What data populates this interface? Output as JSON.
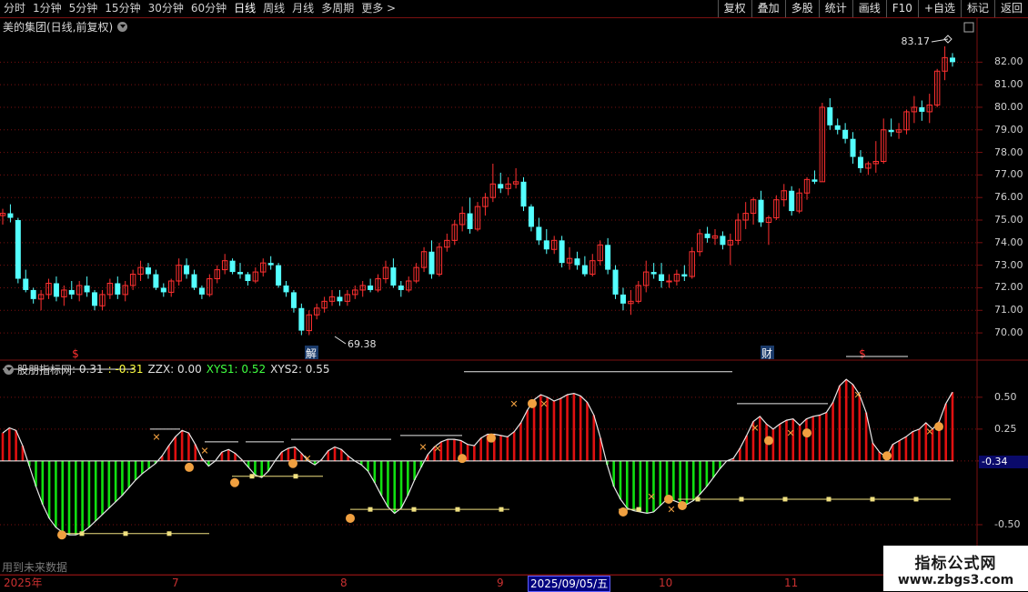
{
  "toolbar": {
    "periods": [
      "分时",
      "1分钟",
      "5分钟",
      "15分钟",
      "30分钟",
      "60分钟",
      "日线",
      "周线",
      "月线",
      "多周期",
      "更多 >"
    ],
    "active_period": "日线",
    "actions": [
      "复权",
      "叠加",
      "多股",
      "统计",
      "画线",
      "F10",
      "+自选",
      "标记",
      "返回"
    ]
  },
  "stock": {
    "title": "美的集团(日线,前复权)"
  },
  "price_axis": [
    "82.00",
    "81.00",
    "80.00",
    "79.00",
    "78.00",
    "77.00",
    "76.00",
    "75.00",
    "74.00",
    "73.00",
    "72.00",
    "71.00",
    "70.00"
  ],
  "annotations": {
    "high": "83.17",
    "low": "69.38",
    "jie": "解",
    "cai": "财",
    "dollar": "$"
  },
  "indicator": {
    "name": "股朋指标网",
    "v1": ": 0.31",
    "v2": ": -0.31",
    "zzx": "ZZX: 0.00",
    "xys1": "XYS1: 0.52",
    "xys2": "XYS2: 0.55"
  },
  "ind_axis": [
    "0.50",
    "0.25",
    "0.00",
    "-0.50"
  ],
  "ind_min": "-0.34",
  "future_label": "用到未来数据",
  "dates": {
    "year": "2025年",
    "m7": "7",
    "m8": "8",
    "m9": "9",
    "cursor": "2025/09/05/五",
    "m10": "10",
    "m11": "11"
  },
  "watermark": {
    "title": "指标公式网",
    "url": "www.zbgs3.com"
  },
  "colors": {
    "up": "#ff3030",
    "down": "#54ffff",
    "bar_up": "#e01010",
    "bar_down": "#10e010",
    "grid": "#7a1010"
  },
  "chart_data": [
    {
      "type": "candlestick",
      "title": "美的集团(日线,前复权)",
      "ylim": [
        69.6,
        82.9
      ],
      "values": [
        [
          75.2,
          75.5,
          74.8,
          75.3
        ],
        [
          75.3,
          75.7,
          74.9,
          75.1
        ],
        [
          75.0,
          75.1,
          72.2,
          72.4
        ],
        [
          72.4,
          72.8,
          71.8,
          71.9
        ],
        [
          71.9,
          72.0,
          71.3,
          71.5
        ],
        [
          71.5,
          71.9,
          71.0,
          71.7
        ],
        [
          71.7,
          72.4,
          71.5,
          72.2
        ],
        [
          72.2,
          72.5,
          71.4,
          71.6
        ],
        [
          71.6,
          72.1,
          71.2,
          71.9
        ],
        [
          71.9,
          72.3,
          71.5,
          71.7
        ],
        [
          71.7,
          72.3,
          71.4,
          72.1
        ],
        [
          72.1,
          72.5,
          71.6,
          71.8
        ],
        [
          71.8,
          71.9,
          71.0,
          71.2
        ],
        [
          71.2,
          71.9,
          71.0,
          71.7
        ],
        [
          71.7,
          72.4,
          71.5,
          72.2
        ],
        [
          72.2,
          72.5,
          71.5,
          71.7
        ],
        [
          71.7,
          72.3,
          71.4,
          72.1
        ],
        [
          72.1,
          72.8,
          71.9,
          72.6
        ],
        [
          72.6,
          73.2,
          72.3,
          72.9
        ],
        [
          72.9,
          73.1,
          72.4,
          72.6
        ],
        [
          72.6,
          72.8,
          71.9,
          72.0
        ],
        [
          72.0,
          72.2,
          71.6,
          71.8
        ],
        [
          71.8,
          72.4,
          71.6,
          72.3
        ],
        [
          72.3,
          73.3,
          72.1,
          73.0
        ],
        [
          73.0,
          73.3,
          72.4,
          72.6
        ],
        [
          72.6,
          72.8,
          71.9,
          72.0
        ],
        [
          72.0,
          72.1,
          71.5,
          71.7
        ],
        [
          71.7,
          72.6,
          71.6,
          72.4
        ],
        [
          72.4,
          73.0,
          72.2,
          72.8
        ],
        [
          72.8,
          73.5,
          72.6,
          73.2
        ],
        [
          73.2,
          73.3,
          72.6,
          72.7
        ],
        [
          72.7,
          73.1,
          72.4,
          72.6
        ],
        [
          72.6,
          72.7,
          72.1,
          72.3
        ],
        [
          72.3,
          72.9,
          72.2,
          72.7
        ],
        [
          72.7,
          73.3,
          72.5,
          73.1
        ],
        [
          73.1,
          73.4,
          72.8,
          73.0
        ],
        [
          73.0,
          73.1,
          72.0,
          72.1
        ],
        [
          72.1,
          72.3,
          71.6,
          71.8
        ],
        [
          71.8,
          71.9,
          70.9,
          71.1
        ],
        [
          71.1,
          71.3,
          69.9,
          70.1
        ],
        [
          70.1,
          71.0,
          69.9,
          70.8
        ],
        [
          70.8,
          71.3,
          70.6,
          71.1
        ],
        [
          71.1,
          71.6,
          70.9,
          71.4
        ],
        [
          71.4,
          71.9,
          71.2,
          71.6
        ],
        [
          71.6,
          71.9,
          71.2,
          71.4
        ],
        [
          71.4,
          71.9,
          71.2,
          71.7
        ],
        [
          71.7,
          72.1,
          71.5,
          71.9
        ],
        [
          71.9,
          72.3,
          71.6,
          72.1
        ],
        [
          72.1,
          72.4,
          71.8,
          71.9
        ],
        [
          71.9,
          72.6,
          71.8,
          72.4
        ],
        [
          72.4,
          73.2,
          72.2,
          72.9
        ],
        [
          72.9,
          73.3,
          72.0,
          72.1
        ],
        [
          72.1,
          72.3,
          71.6,
          71.9
        ],
        [
          71.9,
          72.5,
          71.8,
          72.3
        ],
        [
          72.3,
          73.1,
          72.2,
          72.9
        ],
        [
          72.9,
          73.8,
          72.7,
          73.6
        ],
        [
          73.6,
          74.1,
          72.4,
          72.6
        ],
        [
          72.6,
          74.0,
          72.5,
          73.8
        ],
        [
          73.8,
          74.4,
          73.6,
          74.1
        ],
        [
          74.1,
          75.0,
          73.9,
          74.8
        ],
        [
          74.8,
          75.6,
          74.5,
          75.3
        ],
        [
          75.3,
          76.0,
          74.4,
          74.6
        ],
        [
          74.6,
          75.8,
          74.5,
          75.6
        ],
        [
          75.6,
          76.2,
          75.2,
          76.0
        ],
        [
          76.0,
          77.5,
          75.8,
          76.6
        ],
        [
          76.6,
          77.1,
          76.2,
          76.4
        ],
        [
          76.4,
          76.9,
          76.1,
          76.6
        ],
        [
          76.6,
          77.3,
          76.4,
          76.7
        ],
        [
          76.7,
          76.9,
          75.4,
          75.6
        ],
        [
          75.6,
          75.7,
          74.5,
          74.7
        ],
        [
          74.7,
          75.1,
          73.9,
          74.1
        ],
        [
          74.1,
          74.6,
          73.5,
          73.7
        ],
        [
          73.7,
          74.3,
          73.5,
          74.1
        ],
        [
          74.1,
          74.3,
          72.9,
          73.1
        ],
        [
          73.1,
          73.8,
          72.8,
          73.3
        ],
        [
          73.3,
          73.6,
          72.8,
          73.0
        ],
        [
          73.0,
          73.4,
          72.5,
          72.6
        ],
        [
          72.6,
          73.5,
          72.5,
          73.2
        ],
        [
          73.2,
          74.1,
          73.0,
          73.9
        ],
        [
          73.9,
          74.2,
          72.6,
          72.8
        ],
        [
          72.8,
          73.0,
          71.5,
          71.7
        ],
        [
          71.7,
          72.0,
          71.0,
          71.3
        ],
        [
          71.3,
          71.9,
          70.8,
          71.4
        ],
        [
          71.4,
          72.3,
          71.3,
          72.1
        ],
        [
          72.1,
          73.2,
          71.8,
          72.7
        ],
        [
          72.7,
          73.1,
          72.4,
          72.6
        ],
        [
          72.6,
          73.1,
          72.0,
          72.3
        ],
        [
          72.3,
          72.6,
          72.0,
          72.3
        ],
        [
          72.3,
          72.8,
          72.1,
          72.6
        ],
        [
          72.6,
          73.0,
          72.3,
          72.5
        ],
        [
          72.5,
          73.8,
          72.4,
          73.6
        ],
        [
          73.6,
          74.6,
          73.4,
          74.4
        ],
        [
          74.4,
          74.7,
          74.0,
          74.2
        ],
        [
          74.2,
          74.6,
          73.9,
          74.3
        ],
        [
          74.3,
          74.5,
          73.7,
          73.9
        ],
        [
          73.9,
          74.4,
          73.0,
          74.1
        ],
        [
          74.1,
          75.3,
          73.9,
          75.0
        ],
        [
          75.0,
          75.8,
          74.6,
          75.3
        ],
        [
          75.3,
          76.0,
          74.8,
          75.9
        ],
        [
          75.9,
          76.3,
          74.7,
          74.9
        ],
        [
          74.9,
          75.2,
          73.9,
          75.1
        ],
        [
          75.1,
          76.1,
          75.0,
          75.9
        ],
        [
          75.9,
          76.6,
          75.6,
          76.3
        ],
        [
          76.3,
          76.5,
          75.2,
          75.4
        ],
        [
          75.4,
          76.4,
          75.3,
          76.2
        ],
        [
          76.2,
          76.9,
          75.9,
          76.8
        ],
        [
          76.8,
          77.2,
          76.6,
          76.7
        ],
        [
          76.7,
          80.2,
          76.7,
          80.0
        ],
        [
          80.0,
          80.4,
          79.0,
          79.2
        ],
        [
          79.2,
          79.5,
          78.8,
          79.0
        ],
        [
          79.0,
          79.3,
          78.4,
          78.6
        ],
        [
          78.6,
          78.9,
          77.5,
          77.8
        ],
        [
          77.8,
          78.1,
          77.1,
          77.3
        ],
        [
          77.3,
          77.6,
          77.0,
          77.5
        ],
        [
          77.5,
          78.5,
          77.1,
          77.6
        ],
        [
          77.6,
          79.5,
          77.5,
          79.0
        ],
        [
          79.0,
          79.5,
          78.7,
          78.9
        ],
        [
          78.9,
          79.3,
          78.6,
          79.0
        ],
        [
          79.0,
          79.9,
          78.8,
          79.8
        ],
        [
          79.8,
          80.5,
          79.3,
          80.0
        ],
        [
          80.0,
          80.3,
          79.4,
          79.8
        ],
        [
          79.8,
          80.6,
          79.3,
          80.1
        ],
        [
          80.1,
          81.7,
          80.0,
          81.6
        ],
        [
          81.6,
          82.7,
          81.2,
          82.2
        ],
        [
          82.2,
          82.4,
          81.8,
          82.0
        ]
      ]
    },
    {
      "type": "bar",
      "title": "股朋指标网",
      "ylim": [
        -0.65,
        0.72
      ],
      "values": [
        0.22,
        0.26,
        0.24,
        0.12,
        -0.04,
        -0.2,
        -0.34,
        -0.45,
        -0.52,
        -0.56,
        -0.58,
        -0.58,
        -0.56,
        -0.52,
        -0.47,
        -0.42,
        -0.37,
        -0.32,
        -0.27,
        -0.21,
        -0.15,
        -0.1,
        -0.06,
        -0.02,
        0.04,
        0.12,
        0.19,
        0.24,
        0.22,
        0.13,
        0.02,
        -0.04,
        0.0,
        0.07,
        0.09,
        0.06,
        0.01,
        -0.05,
        -0.11,
        -0.13,
        -0.08,
        0.0,
        0.07,
        0.1,
        0.11,
        0.06,
        0.0,
        -0.03,
        0.01,
        0.08,
        0.11,
        0.09,
        0.04,
        0.0,
        -0.03,
        -0.08,
        -0.17,
        -0.27,
        -0.36,
        -0.41,
        -0.37,
        -0.27,
        -0.15,
        -0.05,
        0.05,
        0.11,
        0.15,
        0.17,
        0.17,
        0.16,
        0.13,
        0.12,
        0.18,
        0.21,
        0.21,
        0.2,
        0.19,
        0.23,
        0.3,
        0.4,
        0.48,
        0.52,
        0.5,
        0.47,
        0.49,
        0.52,
        0.53,
        0.51,
        0.46,
        0.36,
        0.18,
        -0.03,
        -0.2,
        -0.3,
        -0.37,
        -0.39,
        -0.4,
        -0.41,
        -0.4,
        -0.35,
        -0.3,
        -0.31,
        -0.33,
        -0.34,
        -0.31,
        -0.26,
        -0.2,
        -0.13,
        -0.06,
        0.0,
        0.02,
        0.1,
        0.2,
        0.31,
        0.35,
        0.29,
        0.25,
        0.29,
        0.32,
        0.33,
        0.28,
        0.33,
        0.35,
        0.36,
        0.38,
        0.46,
        0.59,
        0.64,
        0.6,
        0.52,
        0.38,
        0.14,
        0.07,
        0.03,
        0.13,
        0.16,
        0.19,
        0.23,
        0.25,
        0.3,
        0.25,
        0.31,
        0.45,
        0.54
      ]
    }
  ]
}
